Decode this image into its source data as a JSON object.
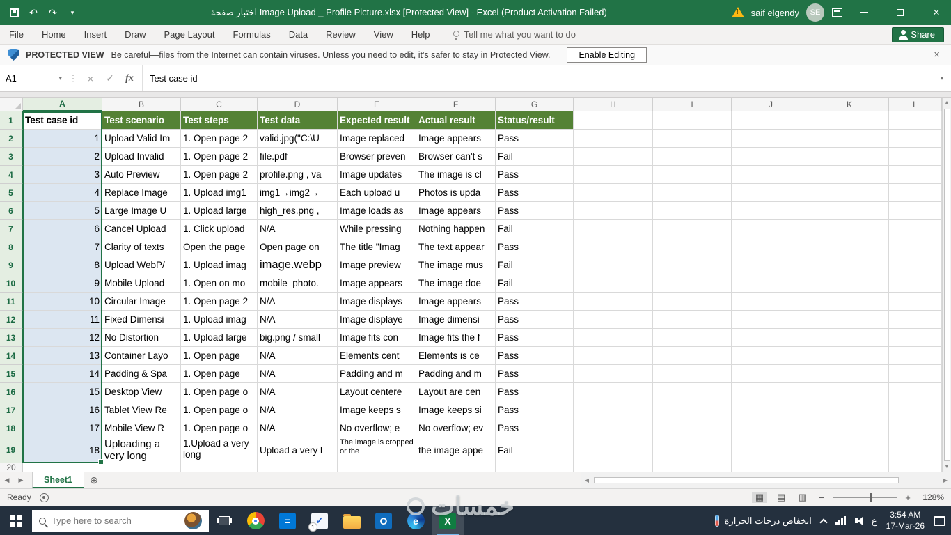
{
  "title_bar": {
    "title": "اختبار صفحة Image Upload _ Profile Picture.xlsx  [Protected View] -  Excel (Product Activation Failed)",
    "user_name": "saif elgendy",
    "avatar_initials": "SE"
  },
  "ribbon": {
    "tabs": [
      "File",
      "Home",
      "Insert",
      "Draw",
      "Page Layout",
      "Formulas",
      "Data",
      "Review",
      "View",
      "Help"
    ],
    "tell_me_label": "Tell me what you want to do",
    "share_label": "Share"
  },
  "message_bar": {
    "label": "PROTECTED VIEW",
    "message": "Be careful—files from the Internet can contain viruses. Unless you need to edit, it's safer to stay in Protected View.",
    "button_label": "Enable Editing"
  },
  "formula_bar": {
    "name_box": "A1",
    "fx_label": "fx",
    "value": "Test case id"
  },
  "sheet": {
    "column_letters": [
      "A",
      "B",
      "C",
      "D",
      "E",
      "F",
      "G",
      "H",
      "I",
      "J",
      "K",
      "L"
    ],
    "header_row": [
      "Test case id",
      "Test scenario",
      "Test steps",
      "Test data",
      "Expected result",
      "Actual result",
      "Status/result"
    ],
    "rows": [
      {
        "id": "1",
        "scenario": "Upload Valid Im",
        "steps": "1. Open page 2",
        "data": "valid.jpg(\"C:\\U",
        "expected": "Image replaced",
        "actual": "Image appears",
        "status": "Pass"
      },
      {
        "id": "2",
        "scenario": "Upload Invalid",
        "steps": "1. Open page 2",
        "data": "file.pdf",
        "expected": "Browser preven",
        "actual": "Browser can't s",
        "status": "Fail"
      },
      {
        "id": "3",
        "scenario": "Auto Preview",
        "steps": "1. Open page 2",
        "data": "profile.png , va",
        "expected": "Image updates",
        "actual": "The image is cl",
        "status": "Pass"
      },
      {
        "id": "4",
        "scenario": "Replace Image",
        "steps": "1. Upload img1",
        "data": "img1→img2→",
        "expected": "Each upload u",
        "actual": "Photos is upda",
        "status": "Pass"
      },
      {
        "id": "5",
        "scenario": "Large Image U",
        "steps": "1. Upload large",
        "data": "high_res.png ,",
        "expected": "Image loads as",
        "actual": "Image appears",
        "status": "Pass"
      },
      {
        "id": "6",
        "scenario": "Cancel Upload",
        "steps": "1. Click upload",
        "data": "N/A",
        "expected": "While pressing",
        "actual": "Nothing happen",
        "status": "Fail"
      },
      {
        "id": "7",
        "scenario": "Clarity of texts",
        "steps": "Open the page",
        "data": "Open page on",
        "expected": "The title \"Imag",
        "actual": "The text appear",
        "status": "Pass"
      },
      {
        "id": "8",
        "scenario": "Upload WebP/",
        "steps": "1. Upload imag",
        "data": "image.webp",
        "expected": "Image preview",
        "actual": "The image mus",
        "status": "Fail",
        "data_large": true
      },
      {
        "id": "9",
        "scenario": "Mobile Upload",
        "steps": "1. Open on mo",
        "data": "mobile_photo.",
        "expected": "Image appears",
        "actual": "The image doe",
        "status": "Fail"
      },
      {
        "id": "10",
        "scenario": "Circular Image",
        "steps": "1. Open page 2",
        "data": "N/A",
        "expected": "Image displays",
        "actual": "Image appears",
        "status": "Pass"
      },
      {
        "id": "11",
        "scenario": "Fixed Dimensi",
        "steps": "1. Upload imag",
        "data": "N/A",
        "expected": "Image displaye",
        "actual": "Image dimensi",
        "status": "Pass"
      },
      {
        "id": "12",
        "scenario": "No Distortion",
        "steps": "1. Upload large",
        "data": "big.png / small",
        "expected": "Image fits con",
        "actual": "Image fits the f",
        "status": "Pass"
      },
      {
        "id": "13",
        "scenario": "Container Layo",
        "steps": "1. Open page",
        "data": "N/A",
        "expected": "Elements cent",
        "actual": "Elements is ce",
        "status": "Pass"
      },
      {
        "id": "14",
        "scenario": "Padding & Spa",
        "steps": "1. Open page",
        "data": "N/A",
        "expected": "Padding and m",
        "actual": "Padding and m",
        "status": "Pass"
      },
      {
        "id": "15",
        "scenario": "Desktop View",
        "steps": "1. Open page o",
        "data": "N/A",
        "expected": "Layout centere",
        "actual": "Layout are cen",
        "status": "Pass"
      },
      {
        "id": "16",
        "scenario": "Tablet View Re",
        "steps": "1. Open page o",
        "data": "N/A",
        "expected": "Image keeps s",
        "actual": "Image keeps si",
        "status": "Pass"
      },
      {
        "id": "17",
        "scenario": "Mobile View R",
        "steps": "1. Open page o",
        "data": "N/A",
        "expected": "No overflow; e",
        "actual": "No overflow; ev",
        "status": "Pass"
      },
      {
        "id": "18",
        "scenario": "Uploading a very long",
        "steps": "1.Upload a very long",
        "data": "Upload a very l",
        "expected": "The image is cropped or the",
        "actual": "the image appe",
        "status": "Fail",
        "tall": true
      }
    ]
  },
  "sheet_tabs": {
    "active_tab": "Sheet1"
  },
  "status_bar": {
    "status": "Ready",
    "zoom": "128%"
  },
  "taskbar": {
    "search_placeholder": "Type here to search",
    "apps": [
      "chrome",
      "calculator",
      "todo",
      "file-explorer",
      "outlook",
      "edge",
      "excel"
    ],
    "tray": {
      "weather": "انخفاض درجات الحرارة",
      "language": "ع",
      "time": "3:54 AM",
      "date": "17-Mar-26"
    }
  },
  "watermark": "خمسات"
}
